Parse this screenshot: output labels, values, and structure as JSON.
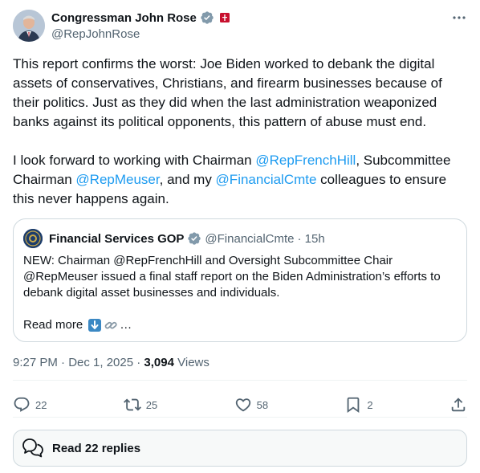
{
  "author": {
    "display_name": "Congressman John Rose",
    "handle": "@RepJohnRose"
  },
  "tweet": {
    "para1": "This report confirms the worst: Joe Biden worked to debank the digital assets of conservatives, Christians, and firearm businesses because of their politics. Just as they did when the last administration weaponized banks against its political opponents, this pattern of abuse must end.",
    "para2_a": "I look forward to working with Chairman ",
    "mention1": "@RepFrenchHill",
    "para2_b": ", Subcommittee Chairman ",
    "mention2": "@RepMeuser",
    "para2_c": ", and my ",
    "mention3": "@FinancialCmte",
    "para2_d": " colleagues to ensure this never happens again."
  },
  "quote": {
    "display_name": "Financial Services GOP",
    "handle": "@FinancialCmte",
    "time": "· 15h",
    "text": "NEW: Chairman @RepFrenchHill and Oversight Subcommittee Chair @RepMeuser issued a final staff report on the Biden Administration’s efforts to debank digital asset businesses and individuals.",
    "read_more": "Read more",
    "ellipsis": "…"
  },
  "meta": {
    "time": "9:27 PM · Dec 1, 2025 · ",
    "views_count": "3,094",
    "views_label": " Views"
  },
  "actions": {
    "replies": "22",
    "reposts": "25",
    "likes": "58",
    "bookmarks": "2"
  },
  "replies_button": {
    "label": "Read 22 replies"
  },
  "colors": {
    "link": "#1d9bf0",
    "verified": "#829aab",
    "text": "#0f1419",
    "muted": "#536471"
  }
}
